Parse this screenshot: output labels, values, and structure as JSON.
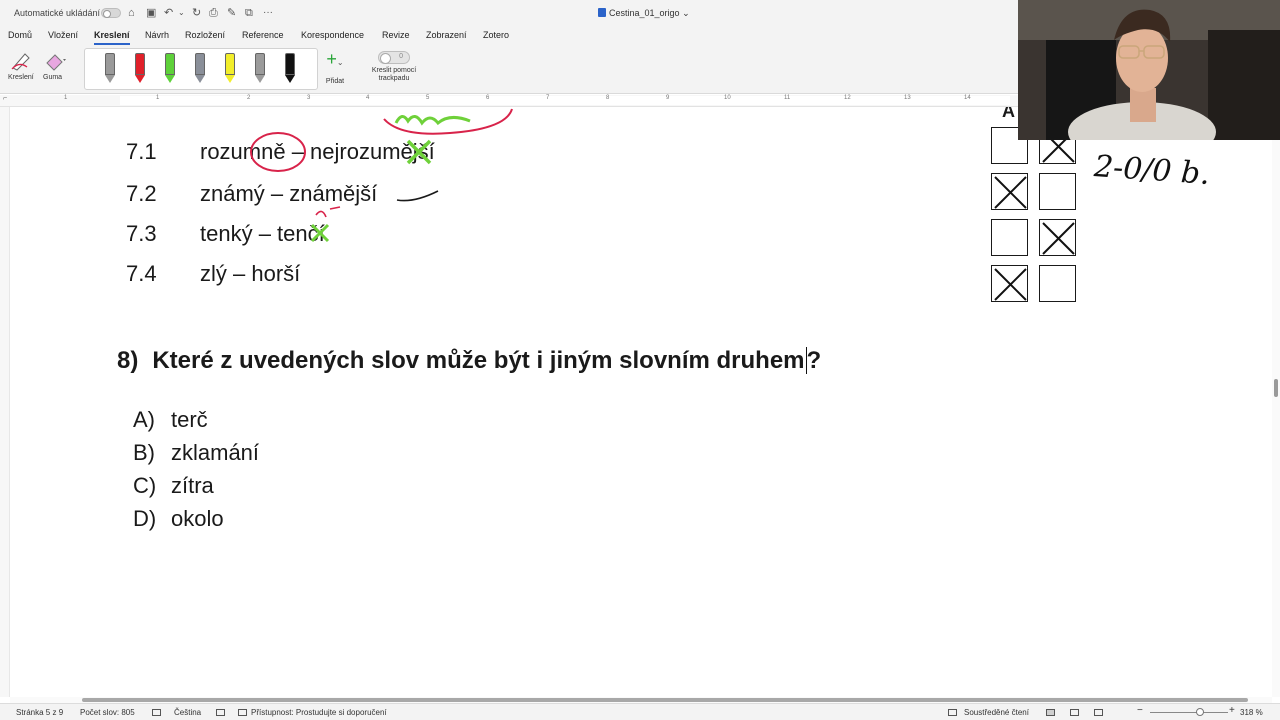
{
  "titlebar": {
    "autosave_label": "Automatické ukládání",
    "more": "···",
    "document_name": "Cestina_01_origo",
    "document_chevron": "⌄"
  },
  "tabs": [
    {
      "label": "Domů",
      "active": false
    },
    {
      "label": "Vložení",
      "active": false
    },
    {
      "label": "Kreslení",
      "active": true
    },
    {
      "label": "Návrh",
      "active": false
    },
    {
      "label": "Rozložení",
      "active": false
    },
    {
      "label": "Reference",
      "active": false
    },
    {
      "label": "Korespondence",
      "active": false
    },
    {
      "label": "Revize",
      "active": false
    },
    {
      "label": "Zobrazení",
      "active": false
    },
    {
      "label": "Zotero",
      "active": false
    }
  ],
  "ribbon": {
    "draw_label": "Kreslení",
    "eraser_label": "Guma",
    "pens": [
      {
        "color": "#9a9a9a"
      },
      {
        "color": "#e0202a"
      },
      {
        "color": "#5ed13a"
      },
      {
        "color": "#8a8f99"
      },
      {
        "color": "#f2ee2b"
      },
      {
        "color": "#9b9b9b"
      },
      {
        "color": "#111111"
      }
    ],
    "add_label": "Přidat",
    "trackpad_label_1": "Kreslit pomocí",
    "trackpad_label_2": "trackpadu",
    "trackpad_state": "0"
  },
  "ruler": {
    "numbers": [
      "1",
      "1",
      "2",
      "3",
      "4",
      "5",
      "6",
      "7",
      "8",
      "9",
      "10",
      "11",
      "12",
      "13",
      "14"
    ]
  },
  "document": {
    "items": [
      {
        "number": "7.1",
        "text": "rozumně – nejrozumější"
      },
      {
        "number": "7.2",
        "text": "známý – známější"
      },
      {
        "number": "7.3",
        "text": "tenký – tenčí"
      },
      {
        "number": "7.4",
        "text": "zlý – horší"
      }
    ],
    "question": {
      "number": "8)",
      "text": "Které z uvedených slov může být i jiným slovním druhem",
      "end": "?"
    },
    "options": [
      {
        "letter": "A)",
        "text": "terč"
      },
      {
        "letter": "B)",
        "text": "zklamání"
      },
      {
        "letter": "C)",
        "text": "zítra"
      },
      {
        "letter": "D)",
        "text": "okolo"
      }
    ],
    "answer_header": "A",
    "answer_grid": [
      [
        false,
        true
      ],
      [
        true,
        false
      ],
      [
        false,
        true
      ],
      [
        true,
        false
      ]
    ],
    "handwritten_score": "2-0/0 b."
  },
  "statusbar": {
    "page": "Stránka 5 z 9",
    "words": "Počet slov: 805",
    "language": "Čeština",
    "accessibility": "Přístupnost: Prostudujte si doporučení",
    "focus": "Soustředěné čtení",
    "zoom": "318 %"
  },
  "colors": {
    "accent": "#2b63c9",
    "ink_red": "#d8234a",
    "ink_green": "#6fd13a"
  }
}
